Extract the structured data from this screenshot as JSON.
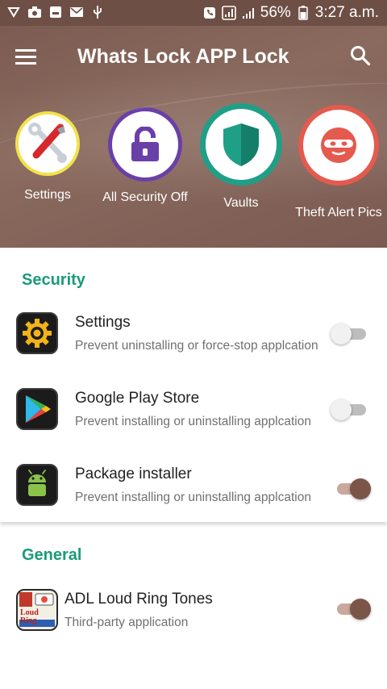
{
  "status_bar": {
    "battery": "56%",
    "time": "3:27 a.m."
  },
  "toolbar": {
    "title": "Whats Lock APP Lock"
  },
  "shortcuts": [
    {
      "label": "Settings",
      "icon": "tools-icon",
      "ring": "#f2e24a"
    },
    {
      "label": "All Security Off",
      "icon": "unlock-icon",
      "ring": "#6a3fa8"
    },
    {
      "label": "Vaults",
      "icon": "shield-icon",
      "ring": "#1f9f86"
    },
    {
      "label": "Theft Alert Pics",
      "icon": "thief-icon",
      "ring": "#e55a4e"
    }
  ],
  "security": {
    "title": "Security",
    "apps": [
      {
        "name": "Settings",
        "desc": "Prevent uninstalling or force-stop applcation",
        "enabled": false
      },
      {
        "name": "Google Play Store",
        "desc": "Prevent installing or uninstalling applcation",
        "enabled": false
      },
      {
        "name": "Package installer",
        "desc": "Prevent installing or uninstalling applcation",
        "enabled": true
      }
    ]
  },
  "general": {
    "title": "General",
    "apps": [
      {
        "name": "ADL Loud Ring Tones",
        "desc": "Third-party application",
        "enabled": true,
        "icon_text": "Loud Ring"
      }
    ]
  },
  "colors": {
    "header": "#7d5d53",
    "accent_green": "#1a9b7a",
    "toggle_on": "#7a5548"
  }
}
